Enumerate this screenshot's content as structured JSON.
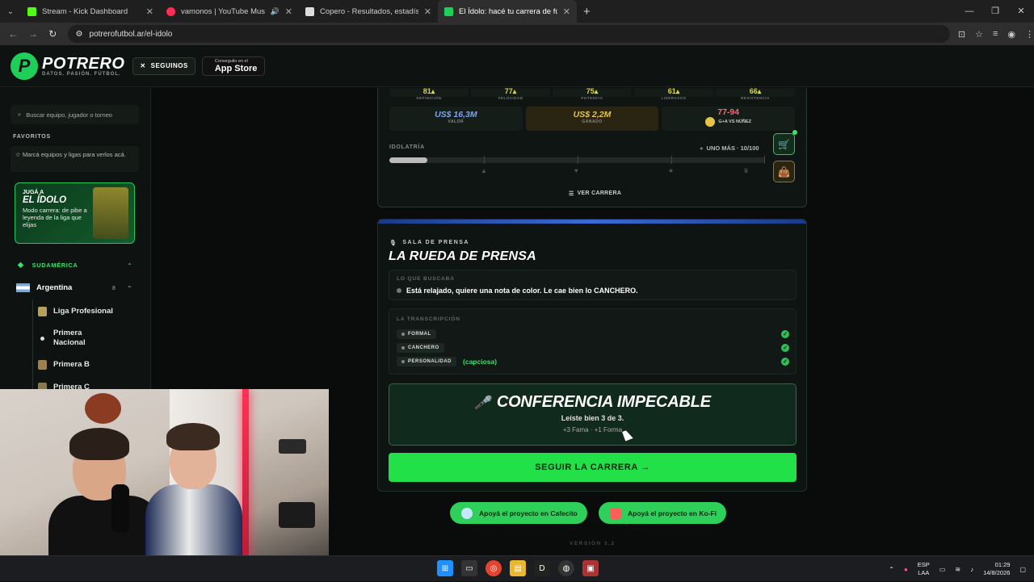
{
  "browser": {
    "tabs": [
      {
        "title": "Stream - Kick Dashboard",
        "color": "#53fc18",
        "active": false
      },
      {
        "title": "vamonos | YouTube Music",
        "color": "#ff2d55",
        "active": false
      },
      {
        "title": "Copero - Resultados, estadístic",
        "color": "#dddddd",
        "active": false
      },
      {
        "title": "El Ídolo: hacé tu carrera de fútb",
        "color": "#1ed05a",
        "active": true
      }
    ],
    "url": "potrerofutbol.ar/el-idolo"
  },
  "header": {
    "logo_name": "POTRERO",
    "logo_tagline": "DATOS. PASIÓN. FÚTBOL.",
    "follow_label": "SEGUINOS",
    "store_small": "Conseguilo en el",
    "store_big": "App Store"
  },
  "sidebar": {
    "search_placeholder": "Buscar equipo, jugador o torneo",
    "favorites_title": "FAVORITOS",
    "favorites_text": "Marcá equipos y ligas para verlos acá.",
    "promo": {
      "pre": "JUGÁ A",
      "title": "EL ÍDOLO",
      "desc": "Modo carrera: de pibe a leyenda de la liga que elijas"
    },
    "region": "SUDAMÉRICA",
    "country": "Argentina",
    "country_count": "8",
    "leagues": [
      "Liga Profesional",
      "Primera Nacional",
      "Primera B",
      "Primera C"
    ]
  },
  "career": {
    "stats": [
      {
        "value": "81",
        "label": "DEFINICIÓN"
      },
      {
        "value": "77",
        "label": "VELOCIDAD"
      },
      {
        "value": "75",
        "label": "POTENCIA"
      },
      {
        "value": "61",
        "label": "LIDERAZGO"
      },
      {
        "value": "66",
        "label": "RESISTENCIA"
      }
    ],
    "valor": {
      "value": "US$ 16,3M",
      "label": "VALOR"
    },
    "ganado": {
      "value": "US$ 2,2M",
      "label": "GANADO"
    },
    "record": {
      "value": "77-94",
      "label": "G+A VS NÚÑEZ"
    },
    "idolatria_label": "IDOLATRÍA",
    "idolatria_rank": "UNO MÁS · 10/100",
    "idolatria_progress": 0.1,
    "ver_carrera": "VER CARRERA"
  },
  "press": {
    "kicker": "SALA DE PRENSA",
    "title": "LA RUEDA DE PRENSA",
    "buscaba_label": "LO QUE BUSCABA",
    "buscaba_text": "Está relajado, quiere una nota de color. Le cae bien lo CANCHERO.",
    "transcripcion_label": "LA TRANSCRIPCIÓN",
    "rows": [
      {
        "tag": "FORMAL",
        "extra": ""
      },
      {
        "tag": "CANCHERO",
        "extra": ""
      },
      {
        "tag": "PERSONALIDAD",
        "extra": "(capciosa)"
      }
    ],
    "result_title": "CONFERENCIA IMPECABLE",
    "result_sub": "Leíste bien 3 de 3.",
    "result_gain": "+3 Fama · +1 Forma",
    "cta": "SEGUIR LA CARRERA →"
  },
  "support": {
    "cafecito": "Apoyá el proyecto en Cafecito",
    "kofi": "Apoyá el proyecto en Ko-Fi"
  },
  "version": "VERSIÓN 3.2",
  "taskbar": {
    "lang_top": "ESP",
    "lang_bottom": "LAA",
    "time": "01:29",
    "date": "14/8/2026"
  }
}
